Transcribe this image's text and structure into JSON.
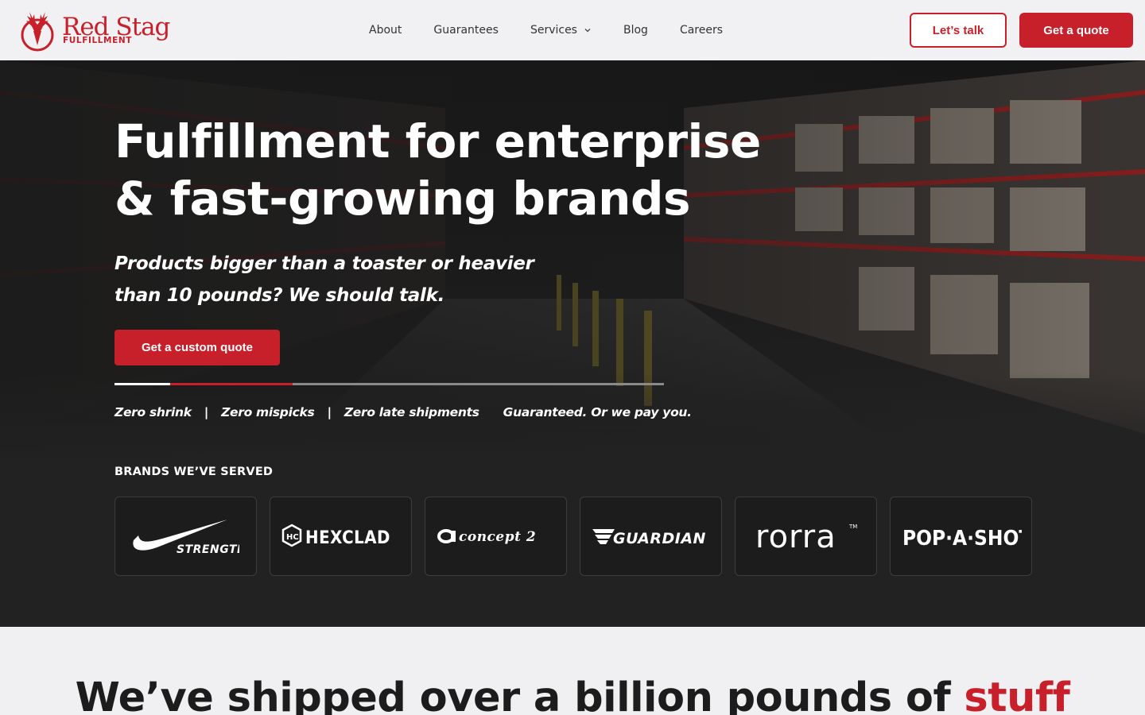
{
  "brand": {
    "name": "Red Stag",
    "sub": "FULFILLMENT",
    "accent_color": "#c8202b"
  },
  "nav": {
    "items": [
      {
        "label": "About"
      },
      {
        "label": "Guarantees"
      },
      {
        "label": "Services",
        "has_dropdown": true
      },
      {
        "label": "Blog"
      },
      {
        "label": "Careers"
      }
    ]
  },
  "header_actions": {
    "talk_label": "Let’s talk",
    "quote_label": "Get a quote"
  },
  "hero": {
    "title_line1": "Fulfillment for enterprise",
    "title_line2": "& fast-growing brands",
    "subtitle_line1": "Products bigger than a toaster or heavier",
    "subtitle_line2": "than 10 pounds? We should talk.",
    "cta_label": "Get a custom quote",
    "guarantees": {
      "item1": "Zero shrink",
      "item2": "Zero mispicks",
      "item3": "Zero late shipments",
      "separator": "|",
      "tagline": "Guaranteed. Or we pay you."
    }
  },
  "brands": {
    "heading": "BRANDS WE’VE SERVED",
    "items": [
      {
        "name": "Nike",
        "wordmark": "STRENGTH"
      },
      {
        "name": "HexClad",
        "wordmark": "HEXCLAD"
      },
      {
        "name": "Concept2",
        "wordmark": "concept 2"
      },
      {
        "name": "Guardian",
        "wordmark": "GUARDIAN"
      },
      {
        "name": "Rorra",
        "wordmark": "rorra"
      },
      {
        "name": "Pop-A-Shot",
        "wordmark": "POP·A·SHOT"
      }
    ]
  },
  "section2": {
    "title_main": "We’ve shipped over a billion pounds of ",
    "title_accent": "stuff"
  }
}
